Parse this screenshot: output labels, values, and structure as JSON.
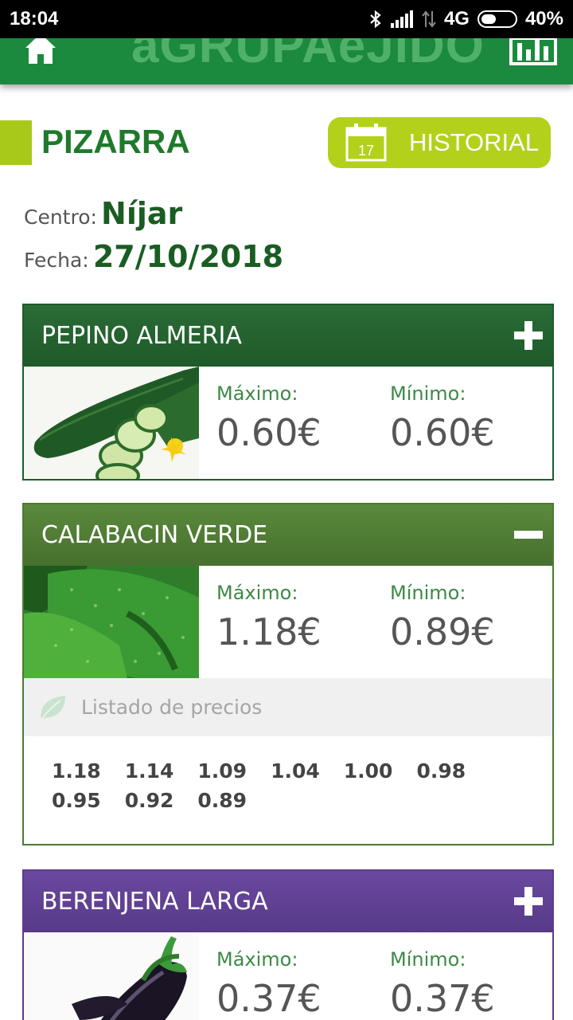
{
  "status_bar": {
    "time": "18:04",
    "network": "4G",
    "battery": "40%"
  },
  "app": {
    "brand": "aGRUPAeJIDO"
  },
  "page": {
    "title": "PIZARRA",
    "historial_label": "HISTORIAL",
    "calendar_day": "17"
  },
  "meta": {
    "centro_label": "Centro:",
    "centro_value": "Níjar",
    "fecha_label": "Fecha:",
    "fecha_value": "27/10/2018"
  },
  "products": [
    {
      "name": "PEPINO ALMERIA",
      "max_label": "Máximo:",
      "max": "0.60€",
      "min_label": "Mínimo:",
      "min": "0.60€",
      "expanded": false
    },
    {
      "name": "CALABACIN VERDE",
      "max_label": "Máximo:",
      "max": "1.18€",
      "min_label": "Mínimo:",
      "min": "0.89€",
      "expanded": true,
      "list_title": "Listado de precios",
      "prices": [
        "1.18",
        "1.14",
        "1.09",
        "1.04",
        "1.00",
        "0.98",
        "0.95",
        "0.92",
        "0.89"
      ]
    },
    {
      "name": "BERENJENA LARGA",
      "max_label": "Máximo:",
      "max": "0.37€",
      "min_label": "Mínimo:",
      "min": "0.37€",
      "expanded": false
    }
  ],
  "icons": {
    "home": "home-icon",
    "stats": "bar-chart-icon",
    "calendar": "calendar-icon",
    "expand": "plus-icon",
    "collapse": "minus-icon",
    "leaf": "leaf-icon"
  },
  "colors": {
    "appbar": "#1b8a3e",
    "accent": "#b3d11b",
    "pepino": "#1f5a2a",
    "calabacin": "#4c7a34",
    "berenjena": "#5d3b8e"
  }
}
